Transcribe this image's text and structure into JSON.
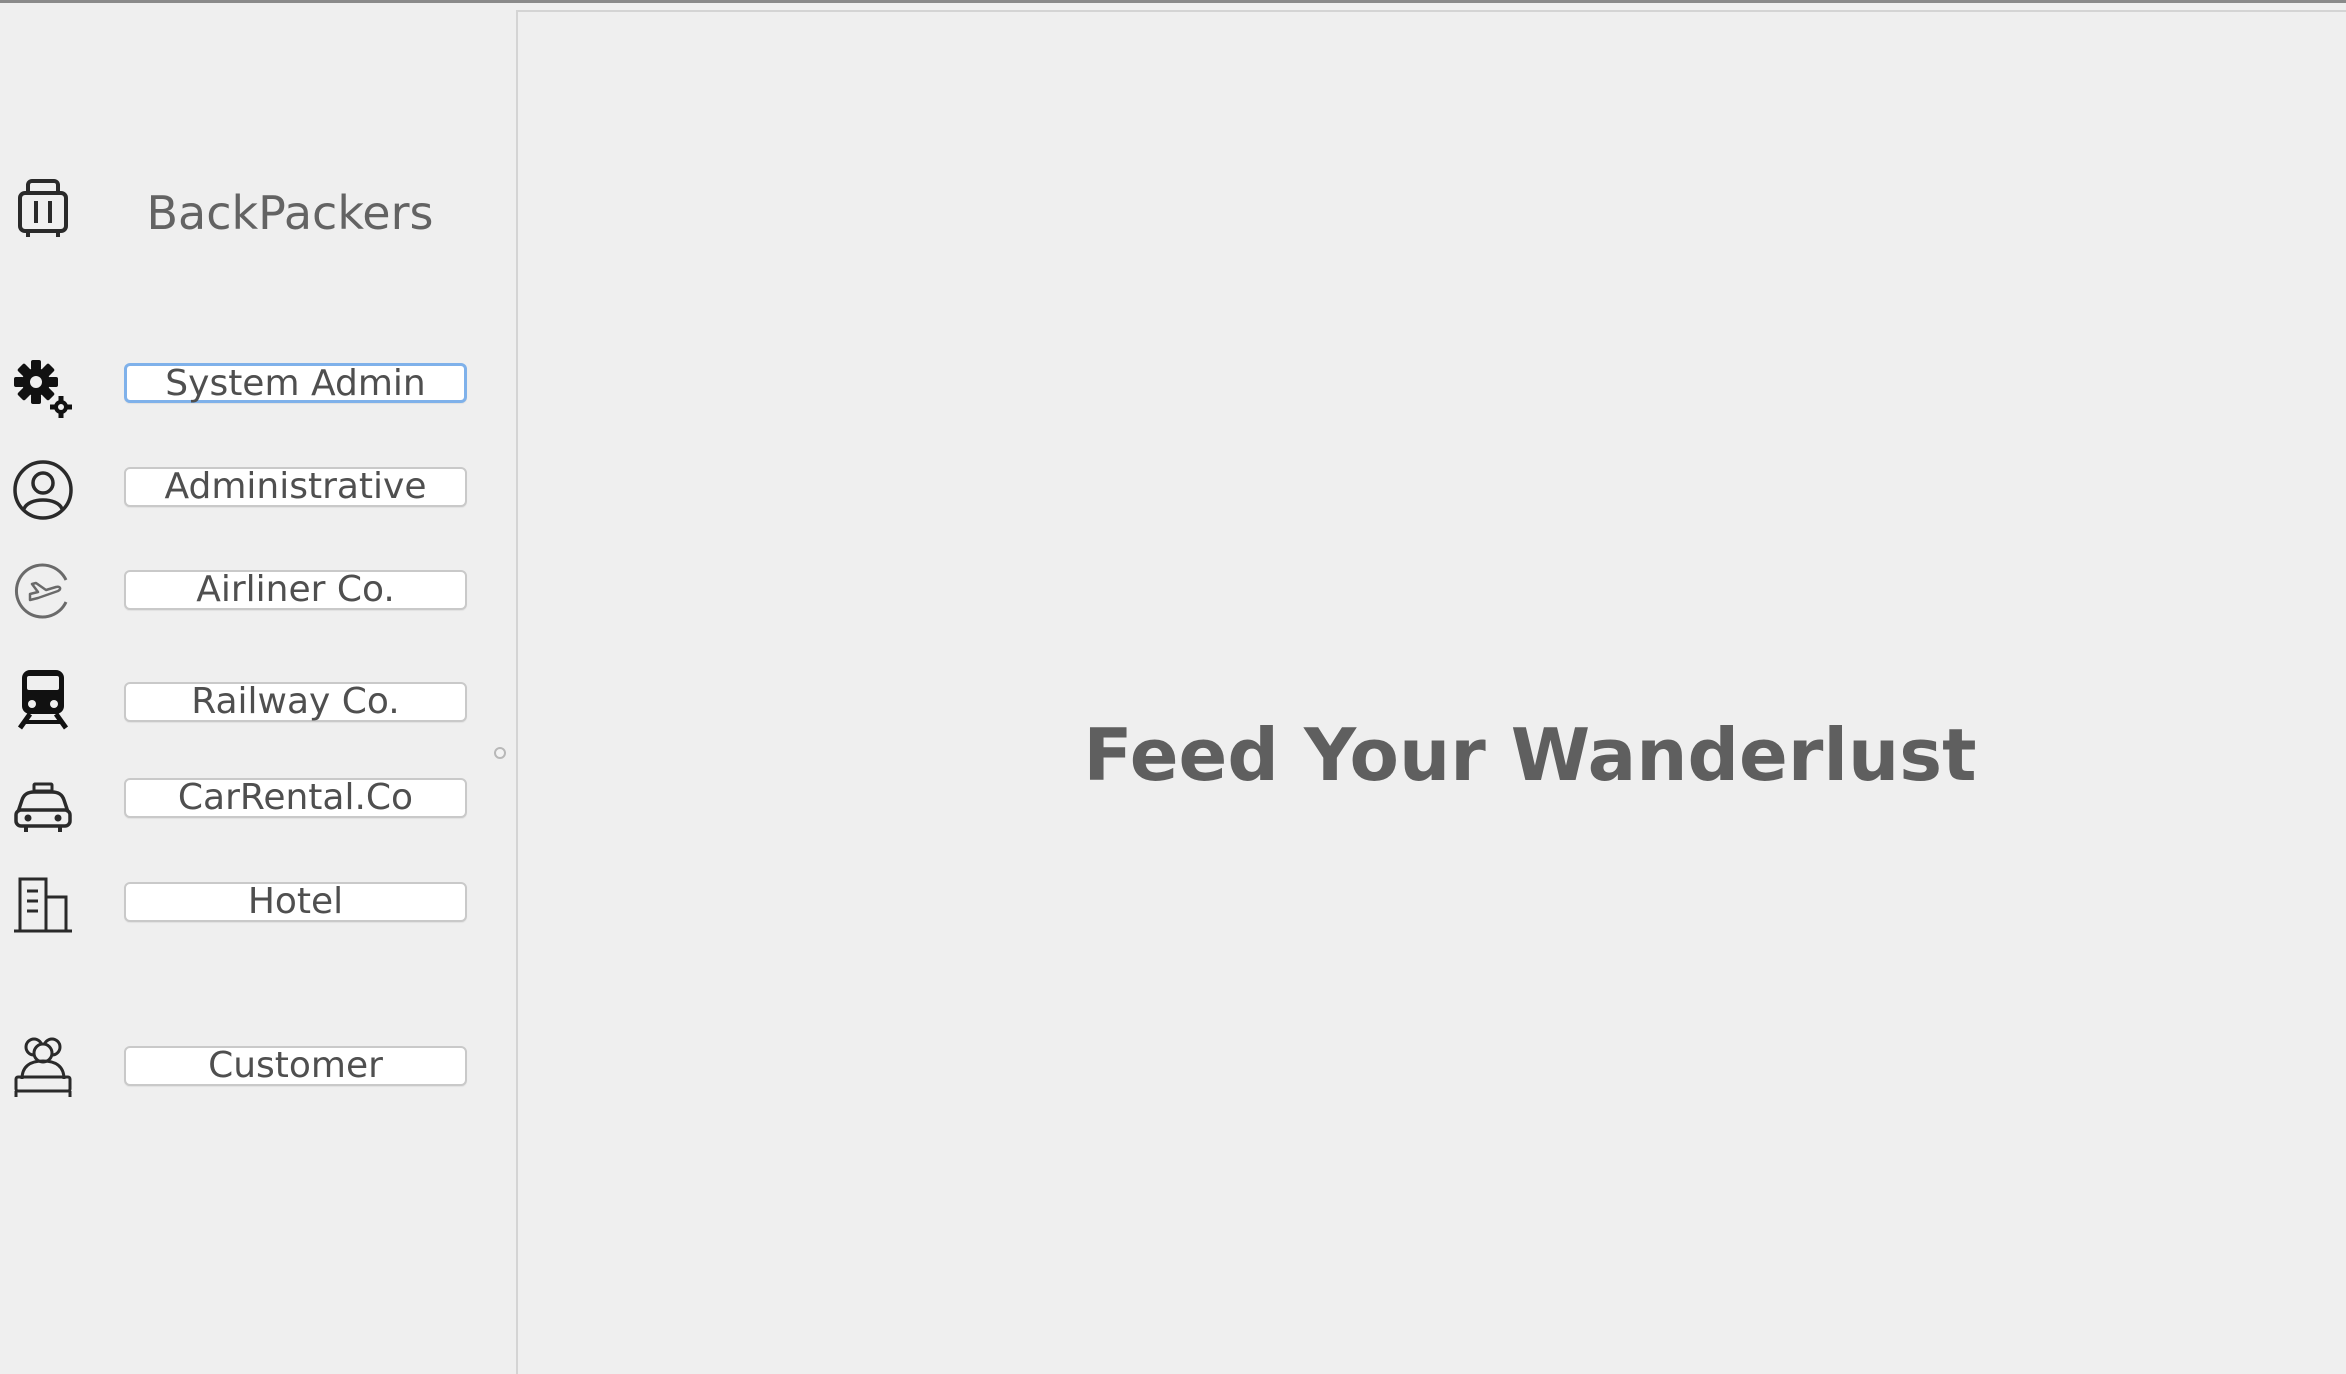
{
  "brand": {
    "title": "BackPackers",
    "icon": "luggage-icon"
  },
  "nav": [
    {
      "id": "system-admin",
      "label": "System Admin",
      "icon": "gears-icon",
      "focused": true
    },
    {
      "id": "administrative",
      "label": "Administrative",
      "icon": "user-circle-icon",
      "focused": false
    },
    {
      "id": "airliner",
      "label": "Airliner Co.",
      "icon": "plane-circle-icon",
      "focused": false
    },
    {
      "id": "railway",
      "label": "Railway Co.",
      "icon": "train-icon",
      "focused": false
    },
    {
      "id": "carrental",
      "label": "CarRental.Co",
      "icon": "car-icon",
      "focused": false
    },
    {
      "id": "hotel",
      "label": "Hotel",
      "icon": "building-icon",
      "focused": false
    },
    {
      "id": "customer",
      "label": "Customer",
      "icon": "people-icon",
      "focused": false
    }
  ],
  "main": {
    "headline": "Feed Your Wanderlust"
  },
  "colors": {
    "background": "#efefef",
    "text": "#5f5f5f",
    "focus_ring": "#7fb1ea"
  }
}
